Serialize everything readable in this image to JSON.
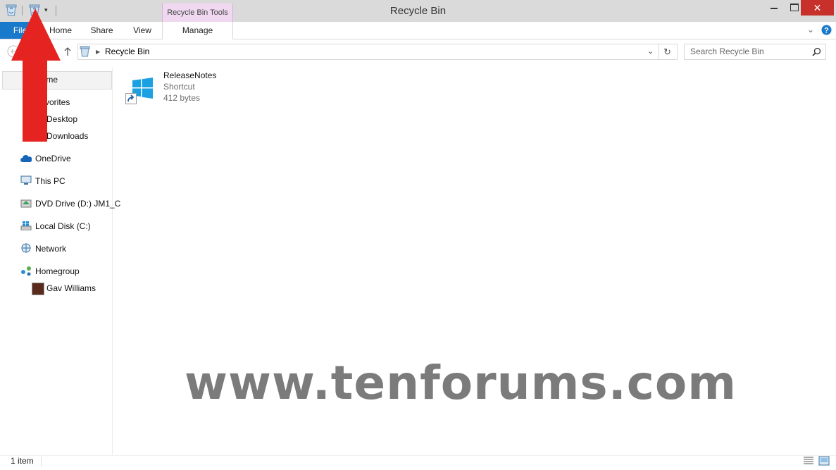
{
  "window": {
    "title": "Recycle Bin",
    "tools_tab": "Recycle Bin Tools"
  },
  "ribbon": {
    "tabs": [
      {
        "label": "File"
      },
      {
        "label": "Home"
      },
      {
        "label": "Share"
      },
      {
        "label": "View"
      },
      {
        "label": "Manage"
      }
    ]
  },
  "address": {
    "location": "Recycle Bin"
  },
  "search": {
    "placeholder": "Search Recycle Bin"
  },
  "nav": {
    "items": [
      {
        "label": "Home"
      },
      {
        "label": "Favorites"
      },
      {
        "label": "Desktop"
      },
      {
        "label": "Downloads"
      },
      {
        "label": "OneDrive"
      },
      {
        "label": "This PC"
      },
      {
        "label": "DVD Drive (D:) JM1_C"
      },
      {
        "label": "Local Disk (C:)"
      },
      {
        "label": "Network"
      },
      {
        "label": "Homegroup"
      },
      {
        "label": "Gav Williams"
      }
    ]
  },
  "files": [
    {
      "name": "ReleaseNotes",
      "type": "Shortcut",
      "size": "412 bytes"
    }
  ],
  "status": {
    "count": "1 item"
  },
  "watermark": "www.tenforums.com",
  "colors": {
    "file_tab": "#1979ca",
    "tools_tab": "#efd8f0",
    "close": "#c7302b",
    "arrow": "#e52320"
  }
}
